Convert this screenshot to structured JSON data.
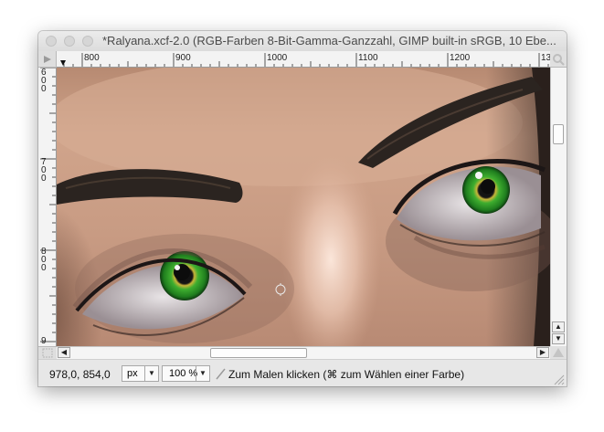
{
  "window": {
    "title": "*Ralyana.xcf-2.0 (RGB-Farben 8-Bit-Gamma-Ganzzahl, GIMP built-in sRGB, 10 Ebe..."
  },
  "ruler": {
    "horizontal_labels": [
      "800",
      "900",
      "1000",
      "1100",
      "1200",
      "13"
    ],
    "vertical_labels": [
      "600",
      "700",
      "800",
      "9"
    ]
  },
  "statusbar": {
    "coordinates": "978,0, 854,0",
    "unit": "px",
    "zoom": "100 %",
    "message": "Zum Malen klicken (⌘ zum Wählen einer Farbe)"
  },
  "icons": {
    "quickmask": "quick-mask-icon",
    "navigate": "navigate-icon",
    "zoom": "zoom-icon",
    "tool": "paintbrush-icon"
  },
  "colors": {
    "skin": "#c79a82",
    "iris": "#2f9a2a",
    "brow": "#2b2420"
  }
}
